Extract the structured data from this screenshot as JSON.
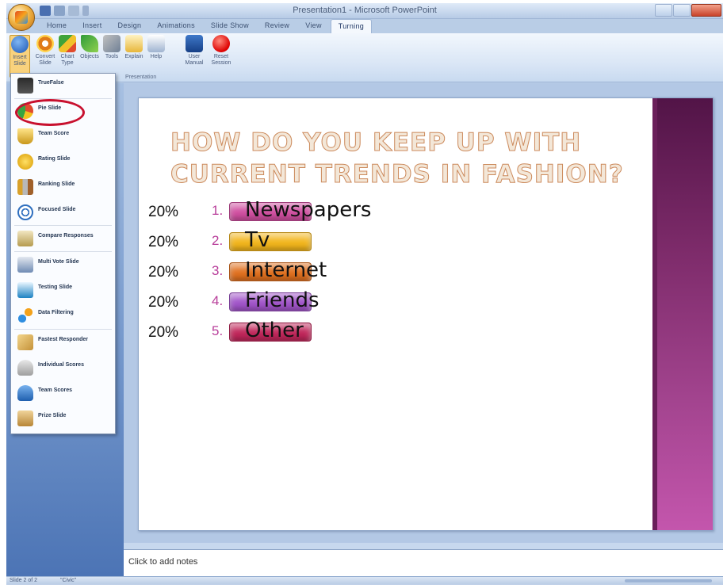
{
  "window": {
    "title": "Presentation1 - Microsoft PowerPoint"
  },
  "tabs": [
    {
      "label": "Home"
    },
    {
      "label": "Insert"
    },
    {
      "label": "Design"
    },
    {
      "label": "Animations"
    },
    {
      "label": "Slide Show"
    },
    {
      "label": "Review"
    },
    {
      "label": "View"
    },
    {
      "label": "Turning"
    }
  ],
  "ribbon": {
    "buttons": [
      {
        "label": "Insert Slide",
        "icon": "help-icon"
      },
      {
        "label": "Convert Slide",
        "icon": "target-icon"
      },
      {
        "label": "Chart Type",
        "icon": "chart-icon"
      },
      {
        "label": "Objects",
        "icon": "check-icon"
      },
      {
        "label": "Tools",
        "icon": "tools-icon"
      },
      {
        "label": "Explain",
        "icon": "explain-icon"
      },
      {
        "label": "Help",
        "icon": "help-doc-icon"
      },
      {
        "label": "User Manual",
        "icon": "manual-icon"
      },
      {
        "label": "Reset Session",
        "icon": "record-icon"
      }
    ],
    "group_label": "Presentation"
  },
  "menu": {
    "items": [
      {
        "label": "TrueFalse",
        "icon": "traffic-light-icon"
      },
      {
        "label": "Pie Slide",
        "icon": "pie-chart-icon"
      },
      {
        "label": "Team Score",
        "icon": "trophy-icon"
      },
      {
        "label": "Rating Slide",
        "icon": "star-icon"
      },
      {
        "label": "Ranking Slide",
        "icon": "ranking-icon"
      },
      {
        "label": "Focused Slide",
        "icon": "focus-icon"
      },
      {
        "label": "Compare Responses",
        "icon": "scale-icon"
      },
      {
        "label": "Multi Vote Slide",
        "icon": "multi-vote-icon"
      },
      {
        "label": "Testing Slide",
        "icon": "test-icon"
      },
      {
        "label": "Data Filtering",
        "icon": "filter-icon"
      },
      {
        "label": "Fastest Responder",
        "icon": "fastest-icon"
      },
      {
        "label": "Individual Scores",
        "icon": "individual-icon"
      },
      {
        "label": "Team Scores",
        "icon": "team-icon"
      },
      {
        "label": "Prize Slide",
        "icon": "prize-icon"
      }
    ]
  },
  "slide": {
    "title_line1": "HOW DO YOU KEEP UP WITH",
    "title_line2": "CURRENT TRENDS IN FASHION?",
    "answers": [
      {
        "pct": "20%",
        "num": "1.",
        "label": "Newspapers",
        "color": "#d04fa0"
      },
      {
        "pct": "20%",
        "num": "2.",
        "label": "Tv",
        "color": "#f2b51c"
      },
      {
        "pct": "20%",
        "num": "3.",
        "label": "Internet",
        "color": "#e0701f"
      },
      {
        "pct": "20%",
        "num": "4.",
        "label": "Friends",
        "color": "#a154c9"
      },
      {
        "pct": "20%",
        "num": "5.",
        "label": "Other",
        "color": "#c0265a"
      }
    ]
  },
  "notes": {
    "placeholder": "Click to add notes"
  },
  "status": {
    "slide": "Slide 2 of 2",
    "theme": "\"Civic\""
  }
}
